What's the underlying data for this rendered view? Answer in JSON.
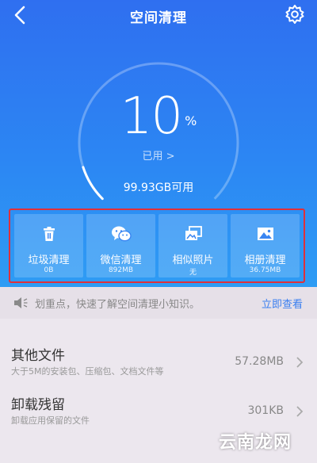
{
  "header": {
    "title": "空间清理"
  },
  "storage": {
    "percent": "10",
    "unit": "%",
    "used_label": "已用 >",
    "available": "99.93GB可用",
    "usage_fraction": 0.1
  },
  "tools": [
    {
      "label": "垃圾清理",
      "value": "0B",
      "icon": "trash-icon"
    },
    {
      "label": "微信清理",
      "value": "892MB",
      "icon": "wechat-icon"
    },
    {
      "label": "相似照片",
      "value": "无",
      "icon": "similar-photos-icon"
    },
    {
      "label": "相册清理",
      "value": "36.75MB",
      "icon": "album-icon"
    }
  ],
  "tip": {
    "text": "划重点，快速了解空间清理小知识。",
    "link": "立即查看"
  },
  "files": [
    {
      "name": "其他文件",
      "desc": "大于5M的安装包、压缩包、文档文件等",
      "size": "57.28MB"
    },
    {
      "name": "卸载残留",
      "desc": "卸载应用保留的文件",
      "size": "301KB"
    }
  ],
  "watermark": "云南龙网",
  "colors": {
    "accent": "#3a7ff0",
    "highlight": "#e0303a"
  }
}
